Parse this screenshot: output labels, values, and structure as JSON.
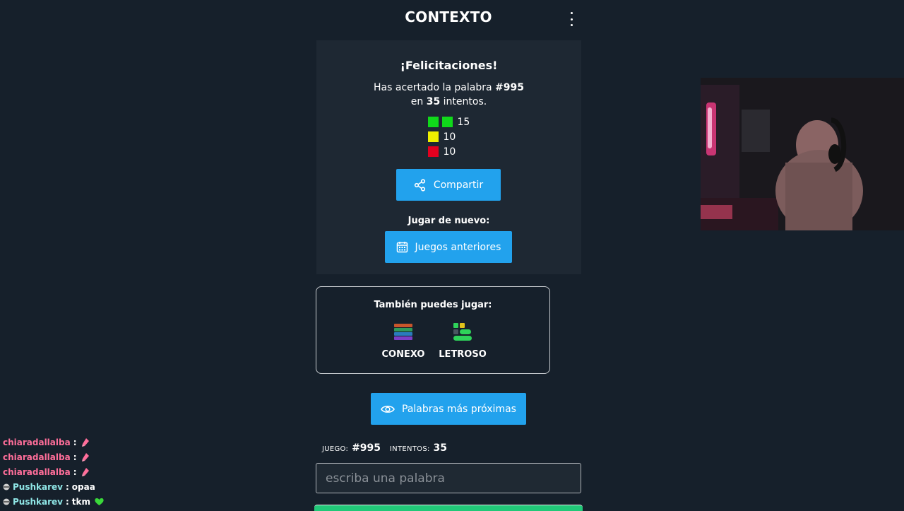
{
  "header": {
    "title": "CONTEXTO",
    "menu_icon": "kebab-menu-icon"
  },
  "result": {
    "title": "¡Felicitaciones!",
    "line1_prefix": "Has acertado la palabra ",
    "game_number": "#995",
    "line2_prefix": "en ",
    "attempts": "35",
    "line2_suffix": " intentos.",
    "stats": [
      {
        "color": "#10d91a",
        "squares": 2,
        "count": "15"
      },
      {
        "color": "#efef00",
        "squares": 1,
        "count": "10"
      },
      {
        "color": "#e3001f",
        "squares": 1,
        "count": "10"
      }
    ]
  },
  "actions": {
    "share_label": "Compartir",
    "share_icon": "share-icon",
    "play_again_label": "Jugar de nuevo:",
    "previous_games_label": "Juegos anteriores",
    "previous_games_icon": "calendar-icon",
    "closest_words_label": "Palabras más próximas",
    "closest_words_icon": "eye-icon"
  },
  "also_play": {
    "title": "También puedes jugar:",
    "games": [
      {
        "name": "CONEXO",
        "icon": "conexo-logo-icon"
      },
      {
        "name": "LETROSO",
        "icon": "letroso-logo-icon"
      }
    ]
  },
  "game_info": {
    "game_label": "JUEGO:",
    "game_value": "#995",
    "attempts_label": "INTENTOS:",
    "attempts_value": "35"
  },
  "input": {
    "placeholder": "escriba una palabra",
    "value": ""
  },
  "chat": [
    {
      "user": "chiaradallalba",
      "separator": ":",
      "message": "",
      "emote": "rocket-emote",
      "color": "#ff6e9a"
    },
    {
      "user": "chiaradallalba",
      "separator": ":",
      "message": "",
      "emote": "rocket-emote",
      "color": "#ff6e9a"
    },
    {
      "user": "chiaradallalba",
      "separator": ":",
      "message": "",
      "emote": "rocket-emote",
      "color": "#ff6e9a"
    },
    {
      "user": "Pushkarev",
      "separator": ":",
      "message": "opaa",
      "badge": "bits-badge",
      "color": "#8fe6e6"
    },
    {
      "user": "Pushkarev",
      "separator": ":",
      "message": "tkm",
      "badge": "bits-badge",
      "emote": "green-heart-emote",
      "color": "#8fe6e6"
    }
  ],
  "colors": {
    "background": "#16202b",
    "panel": "#1e2833",
    "accent_blue": "#22a2ed",
    "submit_green": "#21c878"
  }
}
